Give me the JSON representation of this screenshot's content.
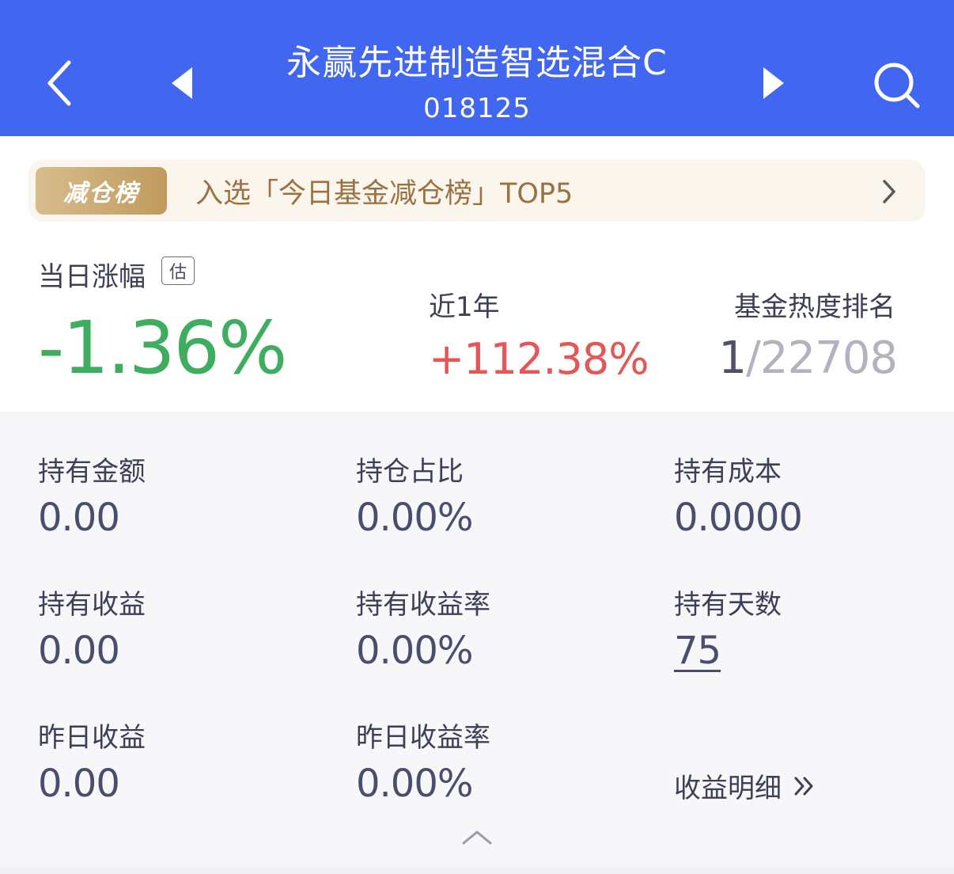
{
  "header": {
    "title": "永赢先进制造智选混合C",
    "code": "018125"
  },
  "banner": {
    "badge": "减仓榜",
    "text": "入选「今日基金减仓榜」TOP5"
  },
  "summary": {
    "daily_change_label": "当日涨幅",
    "estimate_badge": "估",
    "daily_change_value": "-1.36%",
    "year_label": "近1年",
    "year_value": "+112.38%",
    "rank_label": "基金热度排名",
    "rank_position": "1",
    "rank_total": "/22708"
  },
  "holdings": {
    "amount": {
      "label": "持有金额",
      "value": "0.00"
    },
    "position_ratio": {
      "label": "持仓占比",
      "value": "0.00%"
    },
    "cost": {
      "label": "持有成本",
      "value": "0.0000"
    },
    "profit": {
      "label": "持有收益",
      "value": "0.00"
    },
    "profit_rate": {
      "label": "持有收益率",
      "value": "0.00%"
    },
    "days": {
      "label": "持有天数",
      "value": "75"
    },
    "yesterday_profit": {
      "label": "昨日收益",
      "value": "0.00"
    },
    "yesterday_rate": {
      "label": "昨日收益率",
      "value": "0.00%"
    },
    "detail_link": "收益明细"
  },
  "colors": {
    "header_bg": "#4166f0",
    "down_green": "#3fad5f",
    "up_red": "#e45756",
    "banner_gold": "#9a7242"
  },
  "icons": [
    "chevron-left-icon",
    "triangle-left-icon",
    "triangle-right-icon",
    "search-icon",
    "chevron-right-icon",
    "double-chevron-right-icon",
    "chevron-up-icon"
  ]
}
